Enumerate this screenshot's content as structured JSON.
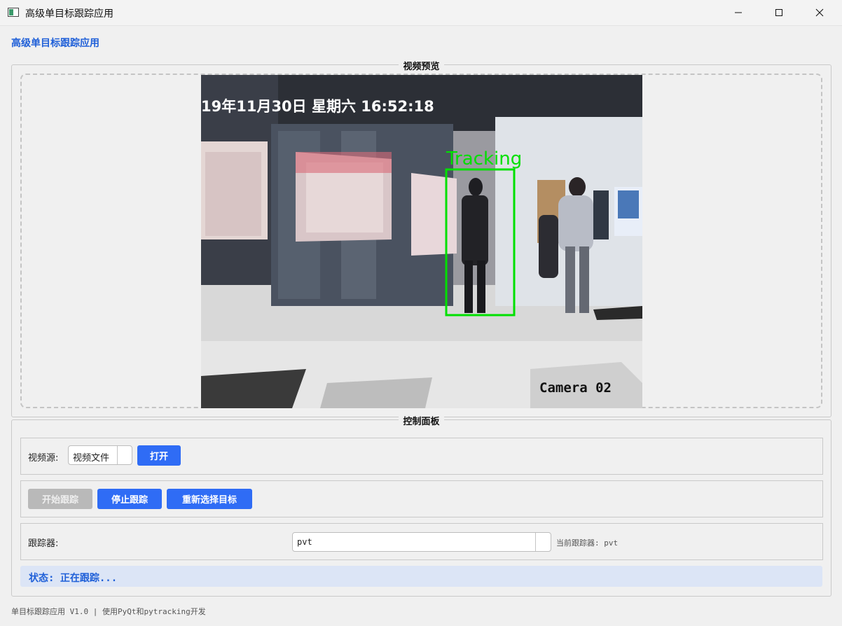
{
  "window": {
    "title": "高级单目标跟踪应用",
    "icon": "app-window-icon",
    "controls": [
      "minimize-icon",
      "maximize-icon",
      "close-icon"
    ]
  },
  "header": {
    "title": "高级单目标跟踪应用"
  },
  "preview": {
    "group_title": "视频预览",
    "overlay": {
      "timestamp": "19年11月30日 星期六 16:52:18",
      "tracking_label": "Tracking",
      "camera_label": "Camera 02"
    }
  },
  "controls": {
    "group_title": "控制面板",
    "source_label": "视频源:",
    "source_value": "视频文件",
    "open_button": "打开",
    "start_button": "开始跟踪",
    "stop_button": "停止跟踪",
    "reselect_button": "重新选择目标",
    "tracker_label": "跟踪器:",
    "tracker_value": "pvt",
    "current_tracker": "当前跟踪器: pvt",
    "status": "状态: 正在跟踪..."
  },
  "footer": {
    "text": "单目标跟踪应用 V1.0 | 使用PyQt和pytracking开发"
  },
  "colors": {
    "accent": "#2f6cf5",
    "title_blue": "#2060d8",
    "tracking_box": "#00e000",
    "status_bg": "#dce5f6",
    "disabled": "#b9b9b9"
  }
}
